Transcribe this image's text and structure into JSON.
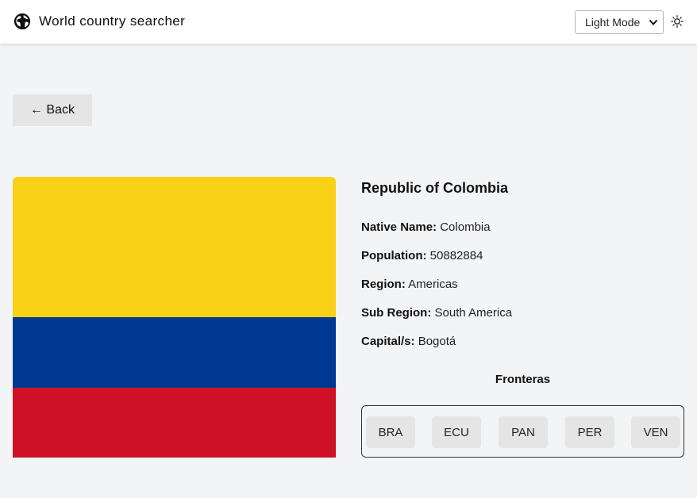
{
  "header": {
    "app_icon": "globe-icon",
    "title": "World country searcher",
    "mode_select": {
      "selected": "Light Mode"
    },
    "theme_icon": "sun-icon"
  },
  "back_button": {
    "label": "← Back"
  },
  "flag": {
    "colors": [
      "#f9d116",
      "#003893",
      "#ce1126"
    ]
  },
  "country": {
    "name": "Republic of Colombia",
    "fields": [
      {
        "label": "Native Name:",
        "value": "Colombia"
      },
      {
        "label": "Population:",
        "value": "50882884"
      },
      {
        "label": "Region:",
        "value": "Americas"
      },
      {
        "label": "Sub Region:",
        "value": "South America"
      },
      {
        "label": "Capital/s:",
        "value": "Bogotá"
      }
    ]
  },
  "borders": {
    "title": "Fronteras",
    "items": [
      "BRA",
      "ECU",
      "PAN",
      "PER",
      "VEN"
    ]
  }
}
